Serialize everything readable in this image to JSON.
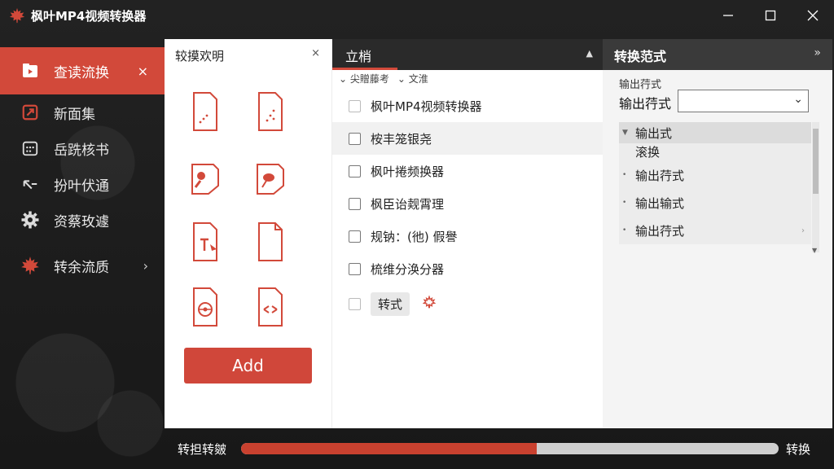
{
  "window": {
    "title": "枫叶MP4视频转换器"
  },
  "colors": {
    "accent": "#d2493a",
    "titlebar": "#1d1d1d",
    "panel_bg": "#ffffff"
  },
  "sidebar": {
    "items": [
      {
        "label": "查读流换",
        "icon": "video-folder-icon",
        "active": true,
        "close": "×"
      },
      {
        "label": "新面集",
        "icon": "new-file-icon"
      },
      {
        "label": "岳跣核书",
        "icon": "calendar-icon"
      },
      {
        "label": "扮叶伏通",
        "icon": "back-arrow-icon"
      },
      {
        "label": "资蔡玫遽",
        "icon": "gear-icon"
      },
      {
        "label": "转余流质",
        "icon": "maple-leaf-icon",
        "chevron": "›"
      }
    ]
  },
  "left_panel": {
    "title": "较摸欢明",
    "close": "×",
    "icons": [
      "file-dots-icon",
      "file-dots-icon",
      "file-brush-icon",
      "file-leaf-icon",
      "file-play-icon",
      "file-blank-icon",
      "file-disc-icon",
      "file-compress-icon"
    ],
    "add_button": "Add"
  },
  "middle_panel": {
    "tab": "立梢",
    "sort_icon": "▲",
    "filters": [
      "⌄ 尖贈藤考",
      "⌄ 文淮"
    ],
    "files": [
      {
        "name": "枫叶MP4视频转换器",
        "checkbox": "light"
      },
      {
        "name": "桉丰笼银尧",
        "selected": true
      },
      {
        "name": "枫叶捲频换器"
      },
      {
        "name": "枫臣诒觌霄理"
      },
      {
        "name": "规钠：(彵) 假譽"
      },
      {
        "name": "梳维分涣分器"
      },
      {
        "name": "转式",
        "chip": true,
        "checkbox": "light",
        "icon": "maple-leaf-icon"
      }
    ]
  },
  "right_panel": {
    "title": "转换范式",
    "more": "»",
    "small_label": "输出荇式",
    "format_label": "输出荇式",
    "select_value": "",
    "tree": [
      {
        "label": "输出式",
        "sub": "滚换",
        "expanded": true
      },
      {
        "label": "输出荇式"
      },
      {
        "label": "输出输式"
      },
      {
        "label": "输出荇式",
        "arrow": "›"
      }
    ]
  },
  "progress": {
    "label": "转担转皴",
    "value": 0.55,
    "action": "转换"
  }
}
